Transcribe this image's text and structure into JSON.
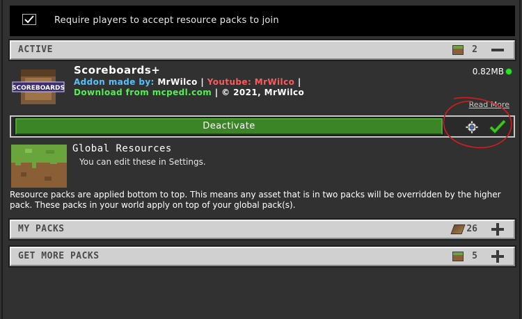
{
  "require": {
    "label": "Require players to accept resource packs to join",
    "checked": true
  },
  "active_section": {
    "title": "ACTIVE",
    "count": "2",
    "toggle": "minus"
  },
  "pack": {
    "title": "Scoreboards+",
    "icon_text": "SCOREBOARDS",
    "line1": {
      "made_by_label": "Addon made by:",
      "author": "MrWilco",
      "sep1": "|",
      "youtube": "Youtube: MrWilco",
      "sep2": "|"
    },
    "line2": {
      "download": "Download from mcpedl.com",
      "sep": "|",
      "copyright": "© 2021, MrWilco"
    },
    "size": "0.82MB",
    "read_more": "Read More"
  },
  "actions": {
    "deactivate": "Deactivate"
  },
  "global": {
    "title": "Global Resources",
    "subtitle": "You can edit these in Settings."
  },
  "info": "Resource packs are applied bottom to top. This means any asset that is in two packs will be overridden by the higher pack. These packs in your world apply on top of your global pack(s).",
  "my_packs": {
    "title": "MY PACKS",
    "count": "26",
    "toggle": "plus"
  },
  "get_more": {
    "title": "GET MORE PACKS",
    "count": "5",
    "toggle": "plus"
  },
  "colors": {
    "accent_green": "#3c8527",
    "status_dot": "#2ee02e",
    "annotation_red": "#d21e1e"
  }
}
